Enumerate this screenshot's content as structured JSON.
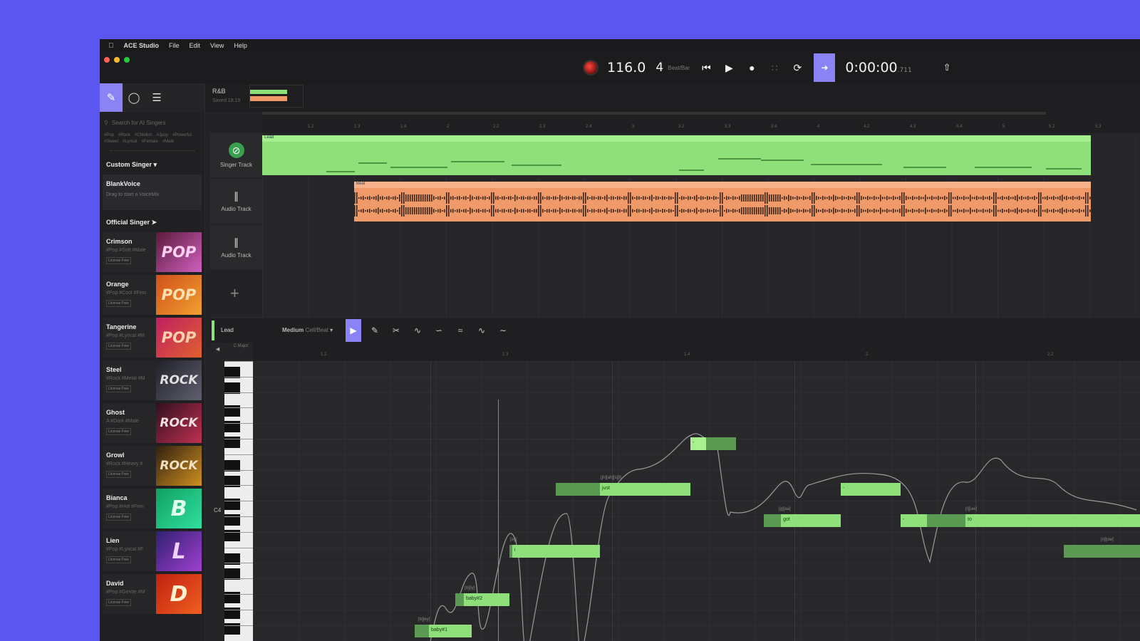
{
  "menubar": {
    "apple": "",
    "app": "ACE Studio",
    "items": [
      "File",
      "Edit",
      "View",
      "Help"
    ]
  },
  "transport": {
    "tempo": "116.0",
    "beats": "4",
    "beat_label": "Beat/Bar",
    "time": "0:00:00",
    "time_ms": ".711"
  },
  "project": {
    "name": "R&B",
    "saved": "Saved 18:19"
  },
  "sidebar": {
    "search_placeholder": "Search for AI Singers",
    "tags": [
      "#Pop",
      "#Rock",
      "#Childish",
      "#Jpop",
      "#Powerful",
      "#Sweet",
      "#Lyrical",
      "#Female",
      "#Male"
    ],
    "custom_title": "Custom Singer",
    "custom_name": "BlankVoice",
    "custom_desc": "Drag to start a VoiceMix",
    "official_title": "Official Singer",
    "singers": [
      {
        "name": "Crimson",
        "tags": "#Pop #Soft #Male",
        "license": "License Free",
        "art": "POP",
        "c1": "#5a1a3a",
        "c2": "#d060c0",
        "fg": "#ffd0f0"
      },
      {
        "name": "Orange",
        "tags": "#Pop #Cool #Fem",
        "license": "License Free",
        "art": "POP",
        "c1": "#d0501a",
        "c2": "#f0a030",
        "fg": "#ffe0b0"
      },
      {
        "name": "Tangerine",
        "tags": "#Pop #Lyrical #M",
        "license": "License Free",
        "art": "POP",
        "c1": "#c02060",
        "c2": "#e06030",
        "fg": "#ffd0b0"
      },
      {
        "name": "Steel",
        "tags": "#Rock #Metal #M",
        "license": "License Free",
        "art": "ROCK",
        "c1": "#202028",
        "c2": "#606070",
        "fg": "#e0e0e0"
      },
      {
        "name": "Ghost",
        "tags": "A #Dark #Male",
        "license": "License Free",
        "art": "ROCK",
        "c1": "#301020",
        "c2": "#c03050",
        "fg": "#f0e0e0"
      },
      {
        "name": "Growl",
        "tags": "#Rock #Heavy #",
        "license": "License Free",
        "art": "ROCK",
        "c1": "#302010",
        "c2": "#d09020",
        "fg": "#f0e0c0"
      },
      {
        "name": "Bianca",
        "tags": "#Pop #Hot #Fem",
        "license": "License Free",
        "art": "B",
        "c1": "#10a060",
        "c2": "#30e0a0",
        "fg": "#e0fff0"
      },
      {
        "name": "Lien",
        "tags": "#Pop #Lyrical #F",
        "license": "License Free",
        "art": "L",
        "c1": "#302070",
        "c2": "#a040d0",
        "fg": "#f0d0ff"
      },
      {
        "name": "David",
        "tags": "#Pop #Gentle #M",
        "license": "License Free",
        "art": "D",
        "c1": "#c02010",
        "c2": "#f06020",
        "fg": "#fff0d0"
      }
    ]
  },
  "tracks": [
    {
      "label": "Singer Track",
      "clip": "Lead"
    },
    {
      "label": "Audio Track",
      "clip": "Beat"
    },
    {
      "label": "Audio Track",
      "clip": ""
    }
  ],
  "editor": {
    "track": "Lead",
    "grid": "Medium",
    "grid_unit": "Cell/Beat",
    "key": "C Major"
  },
  "piano": {
    "c4_label": "C4"
  },
  "notes": [
    {
      "lyric": "baby#1",
      "phon": "[b][ey]"
    },
    {
      "lyric": "baby#2",
      "phon": "[b][iy]"
    },
    {
      "lyric": "i",
      "phon": "[ay]"
    },
    {
      "lyric": "just",
      "phon": "[jh][ah][s][t]"
    },
    {
      "lyric": "-",
      "phon": ""
    },
    {
      "lyric": "got",
      "phon": "[g][aa]"
    },
    {
      "lyric": "-",
      "phon": ""
    },
    {
      "lyric": "-",
      "phon": ""
    },
    {
      "lyric": "to",
      "phon": "[t][uw]"
    },
    {
      "lyric": "know",
      "phon": "[n][ow]"
    }
  ],
  "ruler_ticks": [
    "1.2",
    "1.3",
    "1.4",
    "2",
    "2.2",
    "2.3",
    "2.4",
    "3",
    "3.2",
    "3.3",
    "3.4",
    "4",
    "4.2",
    "4.3",
    "4.4",
    "5",
    "5.2",
    "5.3"
  ],
  "pr_ticks": [
    "1.2",
    "1.3",
    "1.4",
    "2",
    "2.2"
  ]
}
